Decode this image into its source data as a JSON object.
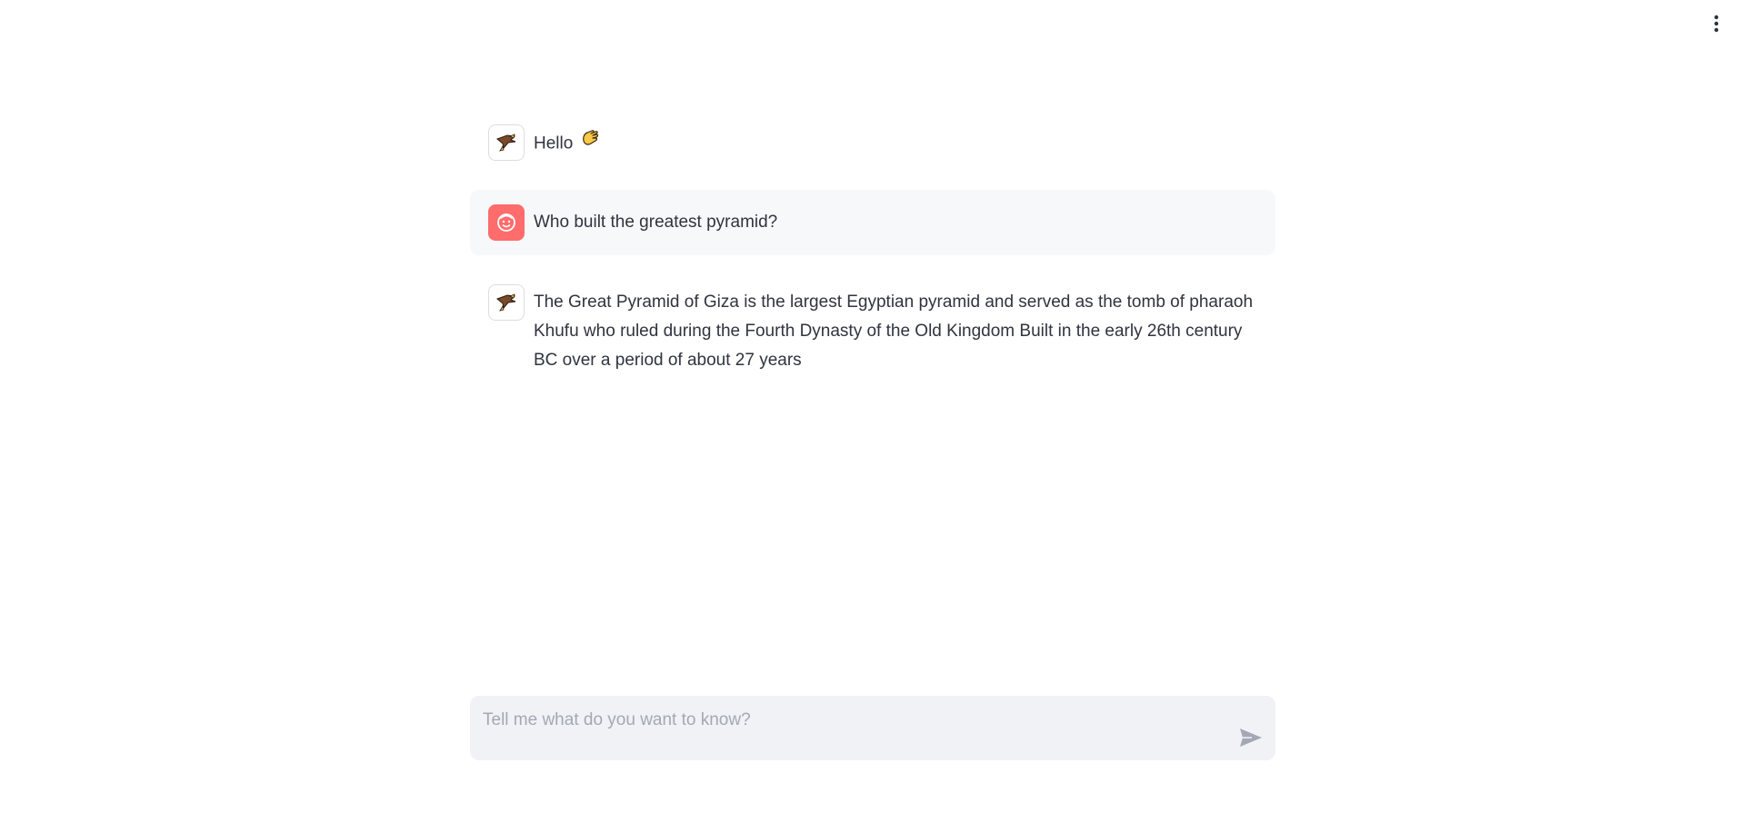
{
  "header": {
    "menu_icon": "vertical-ellipsis-icon"
  },
  "messages": [
    {
      "role": "assistant",
      "avatar_icon": "eagle-icon",
      "text": "Hello",
      "emoji_icon": "waving-hand-icon"
    },
    {
      "role": "user",
      "avatar_icon": "user-face-icon",
      "text": "Who built the greatest pyramid?"
    },
    {
      "role": "assistant",
      "avatar_icon": "eagle-icon",
      "text": "The Great Pyramid of Giza is the largest Egyptian pyramid and served as the tomb of pharaoh Khufu who ruled during the Fourth Dynasty of the Old Kingdom Built in the early 26th century BC over a period of about 27 years"
    }
  ],
  "chat_input": {
    "placeholder": "Tell me what do you want to know?",
    "value": "",
    "send_icon": "send-icon"
  },
  "colors": {
    "user_avatar_bg": "#ff6c6c",
    "user_message_bg": "#f7f8fa",
    "input_bg": "#f0f2f6",
    "text": "#31333f"
  }
}
